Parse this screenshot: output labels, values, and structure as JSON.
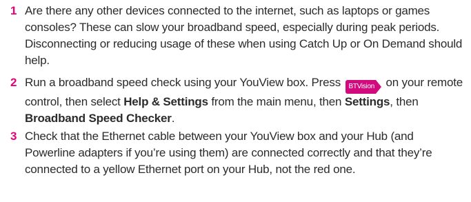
{
  "steps": [
    {
      "number": "1",
      "text": "Are there any other devices connected to the internet, such as laptops or games consoles? These can slow your broadband speed, especially during peak periods. Disconnecting or reducing usage of these when using Catch Up or On Demand should help."
    },
    {
      "number": "2",
      "text_before_badge": "Run a broadband speed check using your YouView box. Press ",
      "badge_label": "BTVision",
      "badge_color": "#d10a7e",
      "text_after_badge": " on your remote control, then select ",
      "bold_1": "Help & Settings",
      "text_mid_1": " from the main menu, then ",
      "bold_2": "Settings",
      "text_mid_2": ", then ",
      "bold_3": "Broadband Speed Checker",
      "text_end": "."
    },
    {
      "number": "3",
      "text": "Check that the Ethernet cable between your YouView box and your Hub (and Powerline adapters if you’re using them) are connected correctly and that they’re connected to a yellow Ethernet port on your Hub, not the red one."
    }
  ],
  "accent_color": "#e3007d"
}
